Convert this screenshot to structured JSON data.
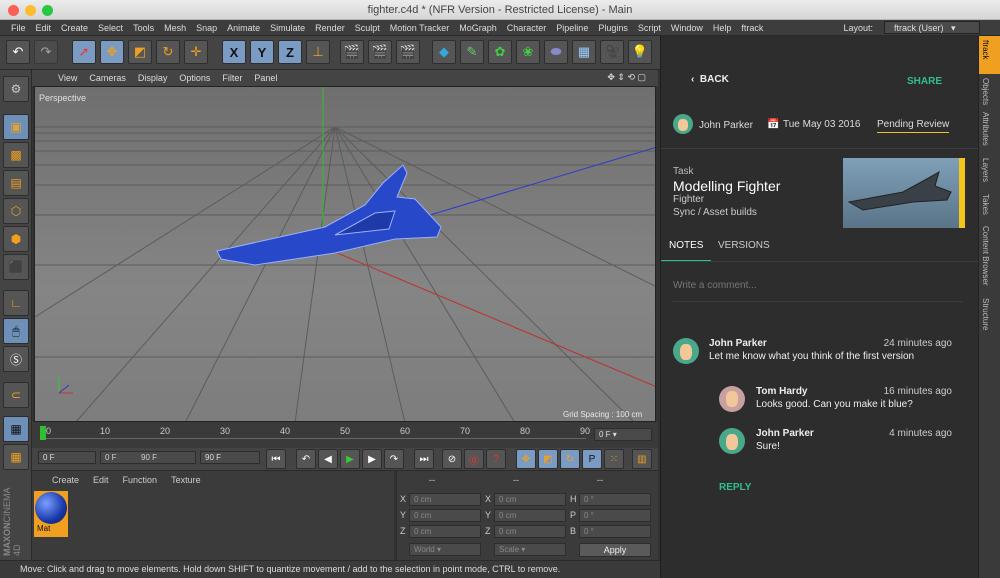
{
  "window": {
    "title": "fighter.c4d * (NFR Version - Restricted License) - Main"
  },
  "menu": [
    "File",
    "Edit",
    "Create",
    "Select",
    "Tools",
    "Mesh",
    "Snap",
    "Animate",
    "Simulate",
    "Render",
    "Sculpt",
    "Motion Tracker",
    "MoGraph",
    "Character",
    "Pipeline",
    "Plugins",
    "Script",
    "Window",
    "Help",
    "ftrack"
  ],
  "layout": {
    "label": "Layout:",
    "value": "ftrack (User)"
  },
  "toolbar": {
    "x": "X",
    "y": "Y",
    "z": "Z"
  },
  "viewport_menu": [
    "View",
    "Cameras",
    "Display",
    "Options",
    "Filter",
    "Panel"
  ],
  "viewport": {
    "label": "Perspective",
    "grid_spacing": "Grid Spacing : 100 cm"
  },
  "timeline": {
    "ticks": [
      "0",
      "10",
      "20",
      "30",
      "40",
      "50",
      "60",
      "70",
      "80",
      "90"
    ],
    "current": "0 F"
  },
  "playback": {
    "start": "0 F",
    "range_start": "0 F",
    "range_end": "90 F",
    "end": "90 F"
  },
  "material_menu": [
    "Create",
    "Edit",
    "Function",
    "Texture"
  ],
  "material": {
    "name": "Mat"
  },
  "coords": {
    "headers": [
      "--",
      "--",
      "--"
    ],
    "rows": [
      {
        "a": "X",
        "av": "0 cm",
        "b": "X",
        "bv": "0 cm",
        "c": "H",
        "cv": "0 °"
      },
      {
        "a": "Y",
        "av": "0 cm",
        "b": "Y",
        "bv": "0 cm",
        "c": "P",
        "cv": "0 °"
      },
      {
        "a": "Z",
        "av": "0 cm",
        "b": "Z",
        "bv": "0 cm",
        "c": "B",
        "cv": "0 °"
      }
    ],
    "world": "World",
    "scale": "Scale",
    "apply": "Apply"
  },
  "status": "Move: Click and drag to move elements. Hold down SHIFT to quantize movement / add to the selection in point mode, CTRL to remove.",
  "brand": {
    "maxon": "MAXON",
    "cinema": "CINEMA 4D"
  },
  "ftrack": {
    "back": "BACK",
    "share": "SHARE",
    "user": "John Parker",
    "date": "Tue May 03 2016",
    "status": "Pending Review",
    "task_label": "Task",
    "task_name": "Modelling Fighter",
    "task_entity": "Fighter",
    "task_path": "Sync / Asset builds",
    "tabs": [
      "NOTES",
      "VERSIONS"
    ],
    "comment_placeholder": "Write a comment...",
    "notes": [
      {
        "author": "John Parker",
        "time": "24 minutes ago",
        "text": "Let me know what you think of the first version"
      },
      {
        "author": "Tom Hardy",
        "time": "16 minutes ago",
        "text": "Looks good. Can you make it blue?"
      },
      {
        "author": "John Parker",
        "time": "4 minutes ago",
        "text": "Sure!"
      }
    ],
    "reply": "REPLY"
  },
  "right_tabs": [
    "ftrack",
    "Objects",
    "Attributes",
    "Layers",
    "Takes",
    "Content Browser",
    "Structure"
  ],
  "colors": {
    "accent": "#2fbf8e",
    "status_underline": "#f2c12e",
    "model": "#2748c8",
    "highlight": "#f5c518"
  }
}
